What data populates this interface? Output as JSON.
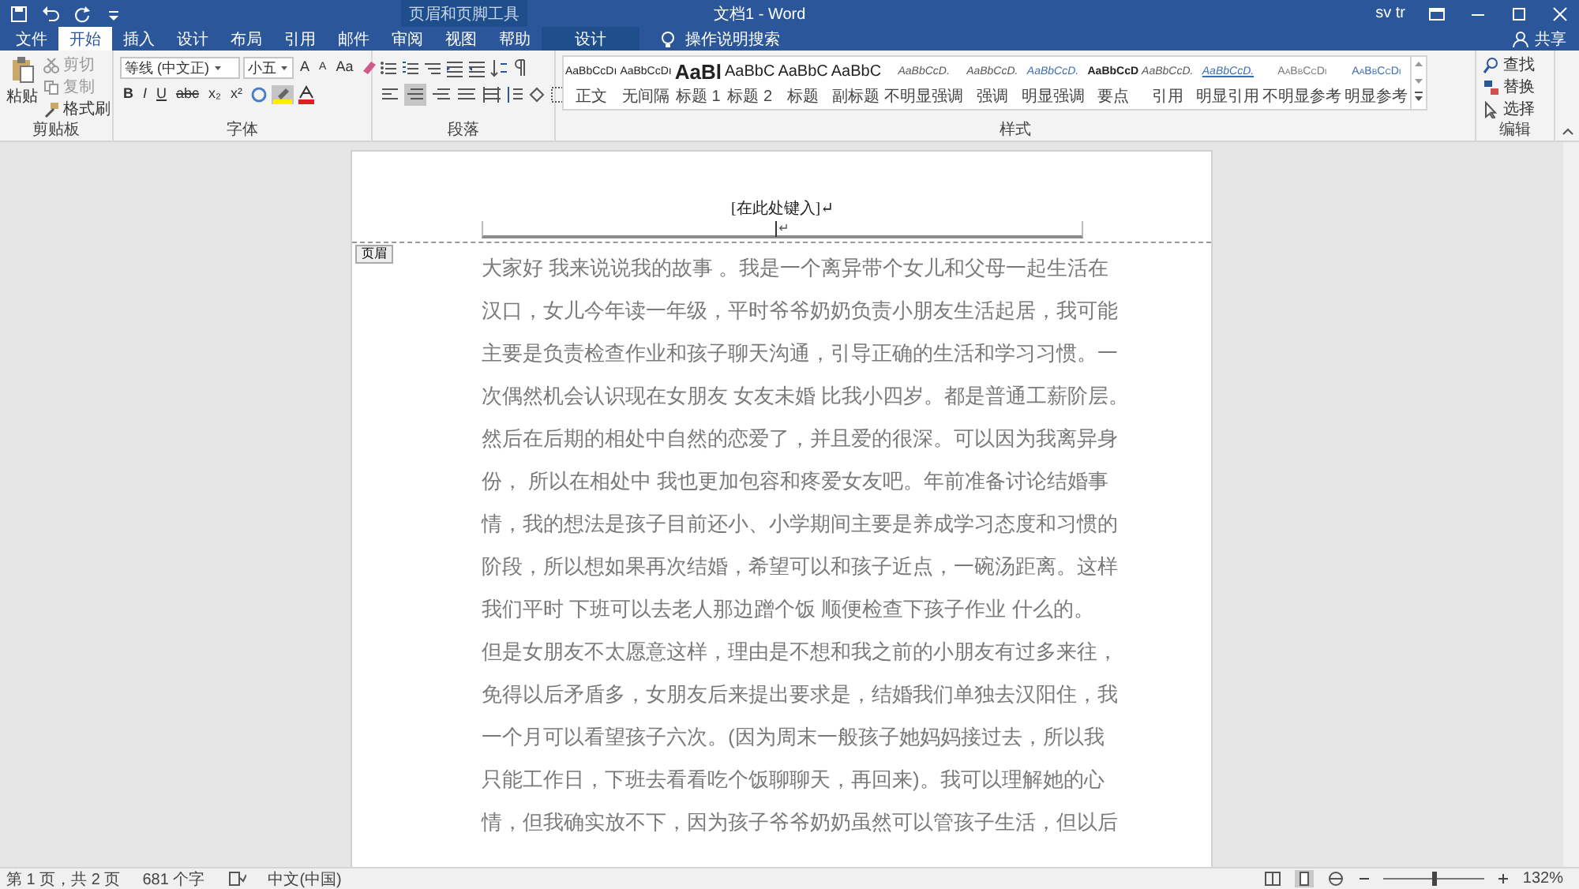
{
  "window": {
    "title": "文档1 - Word",
    "context_label": "页眉和页脚工具",
    "user": "sv tr",
    "share": "共享"
  },
  "tabs": [
    {
      "label": "文件",
      "selected": false
    },
    {
      "label": "开始",
      "selected": true
    },
    {
      "label": "插入",
      "selected": false
    },
    {
      "label": "设计",
      "selected": false
    },
    {
      "label": "布局",
      "selected": false
    },
    {
      "label": "引用",
      "selected": false
    },
    {
      "label": "邮件",
      "selected": false
    },
    {
      "label": "审阅",
      "selected": false
    },
    {
      "label": "视图",
      "selected": false
    },
    {
      "label": "帮助",
      "selected": false
    },
    {
      "label": "设计",
      "selected": false,
      "kind": "context"
    }
  ],
  "tell_me": {
    "placeholder": "操作说明搜索"
  },
  "clipboard": {
    "paste": "粘贴",
    "cut": "剪切",
    "copy": "复制",
    "format_painter": "格式刷",
    "label": "剪贴板"
  },
  "font": {
    "name": "等线 (中文正)",
    "size": "小五",
    "grow": "A",
    "shrink": "A",
    "case": "Aa",
    "bold": "B",
    "italic": "I",
    "underline": "U",
    "strike": "abc",
    "subscript": "x₂",
    "superscript": "x²",
    "label": "字体"
  },
  "paragraph": {
    "label": "段落",
    "alignments": [
      {
        "selected": false
      },
      {
        "selected": true
      },
      {
        "selected": false
      },
      {
        "selected": false
      },
      {
        "selected": false
      }
    ]
  },
  "styles": {
    "label": "样式",
    "items": [
      {
        "preview": "AaBbCcDı",
        "name": "正文",
        "kind": "normal"
      },
      {
        "preview": "AaBbCcDı",
        "name": "无间隔",
        "kind": "normal"
      },
      {
        "preview": "AaBl",
        "name": "标题 1",
        "kind": "heading1"
      },
      {
        "preview": "AaBbC",
        "name": "标题 2",
        "kind": "heading2"
      },
      {
        "preview": "AaBbC",
        "name": "标题",
        "kind": "heading2"
      },
      {
        "preview": "AaBbC",
        "name": "副标题",
        "kind": "heading2"
      },
      {
        "preview": "AaBbCcD.",
        "name": "不明显强调",
        "kind": "emphasis"
      },
      {
        "preview": "AaBbCcD.",
        "name": "强调",
        "kind": "emphasis"
      },
      {
        "preview": "AaBbCcD.",
        "name": "明显强调",
        "kind": "accent"
      },
      {
        "preview": "AaBbCcD",
        "name": "要点",
        "kind": "strong"
      },
      {
        "preview": "AaBbCcD.",
        "name": "引用",
        "kind": "emphasis"
      },
      {
        "preview": "AaBbCcD.",
        "name": "明显引用",
        "kind": "accent-quote"
      },
      {
        "preview": "AaBbCcDı",
        "name": "不明显参考",
        "kind": "reference"
      },
      {
        "preview": "AaBbCcDı",
        "name": "明显参考",
        "kind": "accent-reference"
      }
    ]
  },
  "editing": {
    "find": "查找",
    "replace": "替换",
    "select": "选择",
    "label": "编辑"
  },
  "document": {
    "header_text": "[在此处键入]↵",
    "header_mark": "↵",
    "header_tag": "页眉",
    "lines": [
      "大家好 我来说说我的故事 。我是一个离异带个女儿和父母一起生活在",
      "汉口，女儿今年读一年级，平时爷爷奶奶负责小朋友生活起居，我可能",
      "主要是负责检查作业和孩子聊天沟通，引导正确的生活和学习习惯。一",
      "次偶然机会认识现在女朋友 女友未婚 比我小四岁。都是普通工薪阶层。",
      "然后在后期的相处中自然的恋爱了，并且爱的很深。可以因为我离异身",
      "份， 所以在相处中 我也更加包容和疼爱女友吧。年前准备讨论结婚事",
      "情，我的想法是孩子目前还小、小学期间主要是养成学习态度和习惯的",
      "阶段，所以想如果再次结婚，希望可以和孩子近点，一碗汤距离。这样",
      "我们平时 下班可以去老人那边蹭个饭 顺便检查下孩子作业 什么的。",
      "但是女朋友不太愿意这样，理由是不想和我之前的小朋友有过多来往，",
      "免得以后矛盾多，女朋友后来提出要求是，结婚我们单独去汉阳住，我",
      "一个月可以看望孩子六次。(因为周末一般孩子她妈妈接过去，所以我",
      "只能工作日，下班去看看吃个饭聊聊天，再回来)。我可以理解她的心",
      "情，但我确实放不下，因为孩子爷爷奶奶虽然可以管孩子生活，但以后"
    ]
  },
  "status_bar": {
    "page": "第 1 页，共 2 页",
    "words": "681 个字",
    "language": "中文(中国)",
    "zoom": "132%",
    "zoom_slider": {
      "level": 0.5
    }
  }
}
